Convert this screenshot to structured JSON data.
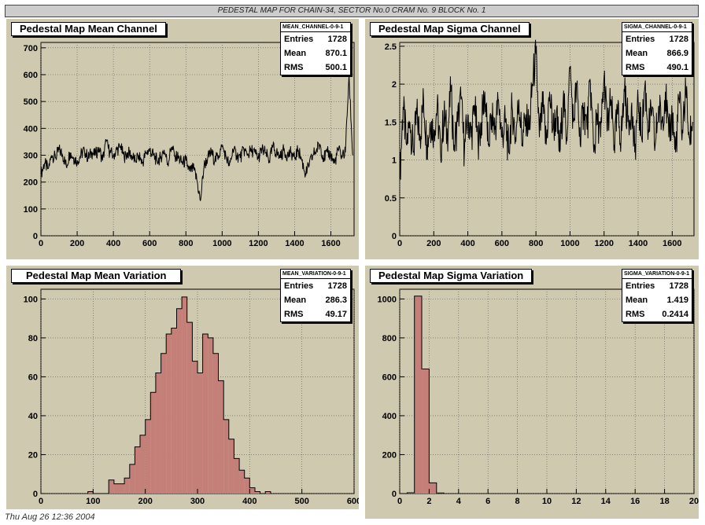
{
  "banner": "PEDESTAL MAP FOR CHAIN-34, SECTOR No.0 CRAM No. 9 BLOCK No. 1",
  "footer": "Thu Aug 26 12:36 2004",
  "colors": {
    "panel_bg": "#cfc9b0",
    "hist_fill": "#c48078",
    "line": "#000000"
  },
  "panels": [
    {
      "title": "Pedestal Map Mean Channel",
      "stats": {
        "name": "MEAN_CHANNEL-0-9-1",
        "entries": "1728",
        "mean": "870.1",
        "rms": "500.1"
      }
    },
    {
      "title": "Pedestal Map Sigma Channel",
      "stats": {
        "name": "SIGMA_CHANNEL-0-9-1",
        "entries": "1728",
        "mean": "866.9",
        "rms": "490.1"
      }
    },
    {
      "title": "Pedestal Map Mean Variation",
      "stats": {
        "name": "MEAN_VARIATION-0-9-1",
        "entries": "1728",
        "mean": "286.3",
        "rms": "49.17"
      }
    },
    {
      "title": "Pedestal Map Sigma Variation",
      "stats": {
        "name": "SIGMA_VARIATION-0-9-1",
        "entries": "1728",
        "mean": "1.419",
        "rms": "0.2414"
      }
    }
  ],
  "labels": {
    "entries": "Entries",
    "mean": "Mean",
    "rms": "RMS"
  },
  "chart_data": [
    {
      "type": "line",
      "title": "Pedestal Map Mean Channel",
      "xlim": [
        0,
        1728
      ],
      "ylim": [
        0,
        720
      ],
      "xticks": [
        0,
        200,
        400,
        600,
        800,
        1000,
        1200,
        1400,
        1600
      ],
      "yticks": [
        0,
        100,
        200,
        300,
        400,
        500,
        600,
        700
      ],
      "x": [
        0,
        20,
        40,
        60,
        80,
        100,
        120,
        140,
        160,
        180,
        200,
        220,
        240,
        260,
        280,
        300,
        320,
        340,
        360,
        380,
        400,
        420,
        440,
        460,
        480,
        500,
        520,
        540,
        560,
        580,
        600,
        620,
        640,
        660,
        680,
        700,
        720,
        740,
        760,
        780,
        800,
        820,
        840,
        860,
        880,
        900,
        920,
        940,
        960,
        980,
        1000,
        1020,
        1040,
        1060,
        1080,
        1100,
        1120,
        1140,
        1160,
        1180,
        1200,
        1220,
        1240,
        1260,
        1280,
        1300,
        1320,
        1340,
        1360,
        1380,
        1400,
        1420,
        1440,
        1460,
        1480,
        1500,
        1520,
        1540,
        1560,
        1580,
        1600,
        1620,
        1640,
        1660,
        1680,
        1700,
        1720
      ],
      "y": [
        230,
        270,
        250,
        300,
        290,
        320,
        300,
        260,
        310,
        290,
        280,
        300,
        320,
        290,
        310,
        300,
        330,
        280,
        350,
        310,
        300,
        320,
        330,
        290,
        310,
        300,
        280,
        300,
        270,
        310,
        320,
        300,
        280,
        290,
        320,
        270,
        330,
        300,
        290,
        270,
        280,
        240,
        250,
        210,
        130,
        260,
        290,
        310,
        280,
        300,
        330,
        300,
        260,
        320,
        300,
        290,
        320,
        300,
        320,
        310,
        290,
        320,
        310,
        280,
        330,
        310,
        290,
        320,
        300,
        310,
        290,
        320,
        280,
        230,
        260,
        300,
        320,
        340,
        290,
        310,
        300,
        270,
        320,
        300,
        310,
        600,
        300
      ]
    },
    {
      "type": "line",
      "title": "Pedestal Map Sigma Channel",
      "xlim": [
        0,
        1728
      ],
      "ylim": [
        0,
        2.55
      ],
      "xticks": [
        0,
        200,
        400,
        600,
        800,
        1000,
        1200,
        1400,
        1600
      ],
      "yticks": [
        0,
        0.5,
        1,
        1.5,
        2,
        2.5
      ],
      "x": [
        0,
        20,
        40,
        60,
        80,
        100,
        120,
        140,
        160,
        180,
        200,
        220,
        240,
        260,
        280,
        300,
        320,
        340,
        360,
        380,
        400,
        420,
        440,
        460,
        480,
        500,
        520,
        540,
        560,
        580,
        600,
        620,
        640,
        660,
        680,
        700,
        720,
        740,
        760,
        780,
        800,
        820,
        840,
        860,
        880,
        900,
        920,
        940,
        960,
        980,
        1000,
        1020,
        1040,
        1060,
        1080,
        1100,
        1120,
        1140,
        1160,
        1180,
        1200,
        1220,
        1240,
        1260,
        1280,
        1300,
        1320,
        1340,
        1360,
        1380,
        1400,
        1420,
        1440,
        1460,
        1480,
        1500,
        1520,
        1540,
        1560,
        1580,
        1600,
        1620,
        1640,
        1660,
        1680,
        1700,
        1720
      ],
      "y": [
        0.75,
        1.7,
        1.2,
        1.5,
        1.1,
        1.6,
        1.3,
        1.8,
        1.2,
        1.5,
        1.4,
        1.7,
        1.1,
        1.6,
        1.3,
        1.9,
        1.2,
        1.5,
        1.8,
        1.1,
        1.6,
        1.3,
        1.7,
        1.2,
        1.5,
        1.9,
        1.2,
        1.6,
        1.4,
        1.8,
        1.3,
        1.5,
        1.1,
        1.7,
        1.3,
        1.8,
        1.2,
        1.6,
        1.4,
        2.0,
        2.4,
        1.3,
        1.7,
        1.2,
        1.9,
        1.4,
        1.6,
        1.1,
        1.8,
        1.3,
        2.2,
        1.5,
        2.0,
        1.2,
        1.7,
        1.4,
        2.0,
        1.1,
        1.6,
        1.3,
        2.1,
        1.4,
        1.8,
        1.2,
        1.6,
        1.3,
        1.9,
        1.5,
        1.7,
        1.1,
        1.8,
        1.3,
        2.0,
        1.4,
        1.6,
        1.2,
        1.7,
        1.5,
        1.9,
        1.3,
        1.6,
        1.1,
        1.8,
        1.4,
        1.9,
        1.3,
        1.5
      ]
    },
    {
      "type": "bar",
      "title": "Pedestal Map Mean Variation",
      "xlim": [
        0,
        600
      ],
      "ylim": [
        0,
        105
      ],
      "xticks": [
        0,
        100,
        200,
        300,
        400,
        500,
        600
      ],
      "yticks": [
        0,
        20,
        40,
        60,
        80,
        100
      ],
      "bin_edges": [
        90,
        100,
        110,
        120,
        130,
        140,
        150,
        160,
        170,
        180,
        190,
        200,
        210,
        220,
        230,
        240,
        250,
        260,
        270,
        280,
        290,
        300,
        310,
        320,
        330,
        340,
        350,
        360,
        370,
        380,
        390,
        400,
        410,
        420,
        430,
        440
      ],
      "values": [
        1,
        0,
        0,
        0,
        7,
        5,
        5,
        8,
        15,
        24,
        30,
        38,
        52,
        62,
        72,
        82,
        85,
        95,
        101,
        88,
        68,
        62,
        82,
        80,
        72,
        58,
        38,
        28,
        18,
        12,
        8,
        3,
        1,
        0,
        1
      ]
    },
    {
      "type": "bar",
      "title": "Pedestal Map Sigma Variation",
      "xlim": [
        0,
        20
      ],
      "ylim": [
        0,
        1050
      ],
      "xticks": [
        0,
        2,
        4,
        6,
        8,
        10,
        12,
        14,
        16,
        18,
        20
      ],
      "yticks": [
        0,
        200,
        400,
        600,
        800,
        1000
      ],
      "bin_edges": [
        0,
        0.5,
        1.0,
        1.5,
        2.0,
        2.5,
        3.0
      ],
      "values": [
        0,
        4,
        1015,
        640,
        55,
        3
      ]
    }
  ]
}
